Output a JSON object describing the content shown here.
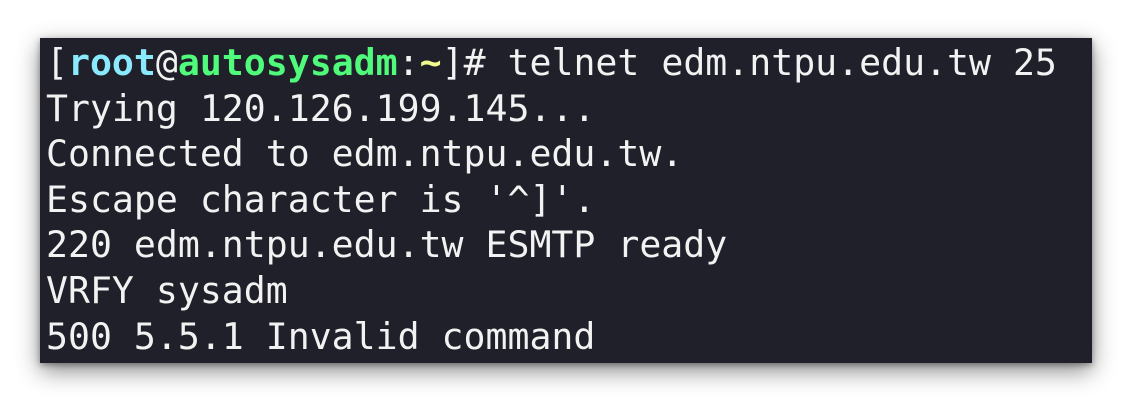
{
  "prompt": {
    "open_bracket": "[",
    "user": "root",
    "at": "@",
    "host": "autosysadm",
    "colon": ":",
    "path": "~",
    "close": "]# ",
    "command": "telnet edm.ntpu.edu.tw 25"
  },
  "output": [
    "Trying 120.126.199.145...",
    "Connected to edm.ntpu.edu.tw.",
    "Escape character is '^]'.",
    "220 edm.ntpu.edu.tw ESMTP ready",
    "VRFY sysadm",
    "500 5.5.1 Invalid command"
  ],
  "colors": {
    "background": "#1f2029",
    "text": "#f2f2f2",
    "user": "#8be9fd",
    "host": "#50fa7b",
    "path": "#f1fa8c"
  }
}
